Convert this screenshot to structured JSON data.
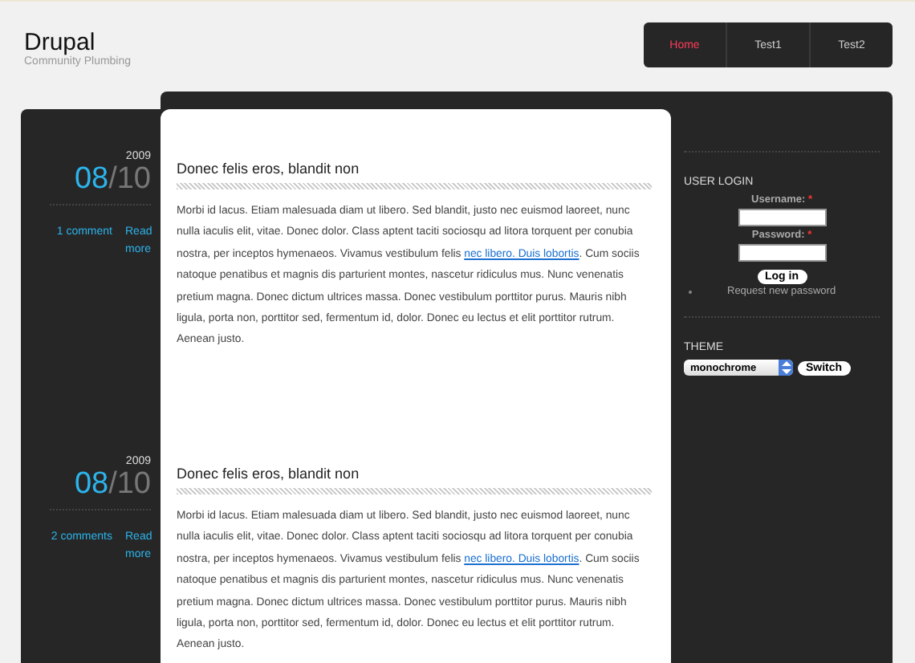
{
  "site": {
    "name": "Drupal",
    "slogan": "Community Plumbing"
  },
  "nav": [
    {
      "label": "Home",
      "selected": true
    },
    {
      "label": "Test1",
      "selected": false
    },
    {
      "label": "Test2",
      "selected": false
    }
  ],
  "posts": [
    {
      "year": "2009",
      "month": "08",
      "separator": "/",
      "day": "10",
      "comments": "1 comment",
      "read_more": "Read more",
      "title": "Donec felis eros, blandit non",
      "text_before": "Morbi id lacus. Etiam malesuada diam ut libero. Sed blandit, justo nec euismod laoreet, nunc nulla iaculis elit, vitae. Donec dolor. Class aptent taciti sociosqu ad litora torquent per conubia nostra, per inceptos hymenaeos. Vivamus vestibulum felis ",
      "link": "nec libero. Duis lobortis",
      "text_after": ". Cum sociis natoque penatibus et magnis dis parturient montes, nascetur ridiculus mus. Nunc venenatis pretium magna. Donec dictum ultrices massa. Donec vestibulum porttitor purus. Mauris nibh ligula, porta non, porttitor sed, fermentum id, dolor. Donec eu lectus et elit porttitor rutrum. Aenean justo."
    },
    {
      "year": "2009",
      "month": "08",
      "separator": "/",
      "day": "10",
      "comments": "2 comments",
      "read_more": "Read more",
      "title": "Donec felis eros, blandit non",
      "text_before": "Morbi id lacus. Etiam malesuada diam ut libero. Sed blandit, justo nec euismod laoreet, nunc nulla iaculis elit, vitae. Donec dolor. Class aptent taciti sociosqu ad litora torquent per conubia nostra, per inceptos hymenaeos. Vivamus vestibulum felis ",
      "link": "nec libero. Duis lobortis",
      "text_after": ". Cum sociis natoque penatibus et magnis dis parturient montes, nascetur ridiculus mus. Nunc venenatis pretium magna. Donec dictum ultrices massa. Donec vestibulum porttitor purus. Mauris nibh ligula, porta non, porttitor sed, fermentum id, dolor. Donec eu lectus et elit porttitor rutrum. Aenean justo."
    }
  ],
  "login": {
    "title": "USER LOGIN",
    "username_label": "Username:",
    "password_label": "Password:",
    "required_mark": "*",
    "button": "Log in",
    "request_link": "Request new password"
  },
  "theme": {
    "title": "THEME",
    "value": "monochrome",
    "button": "Switch"
  }
}
